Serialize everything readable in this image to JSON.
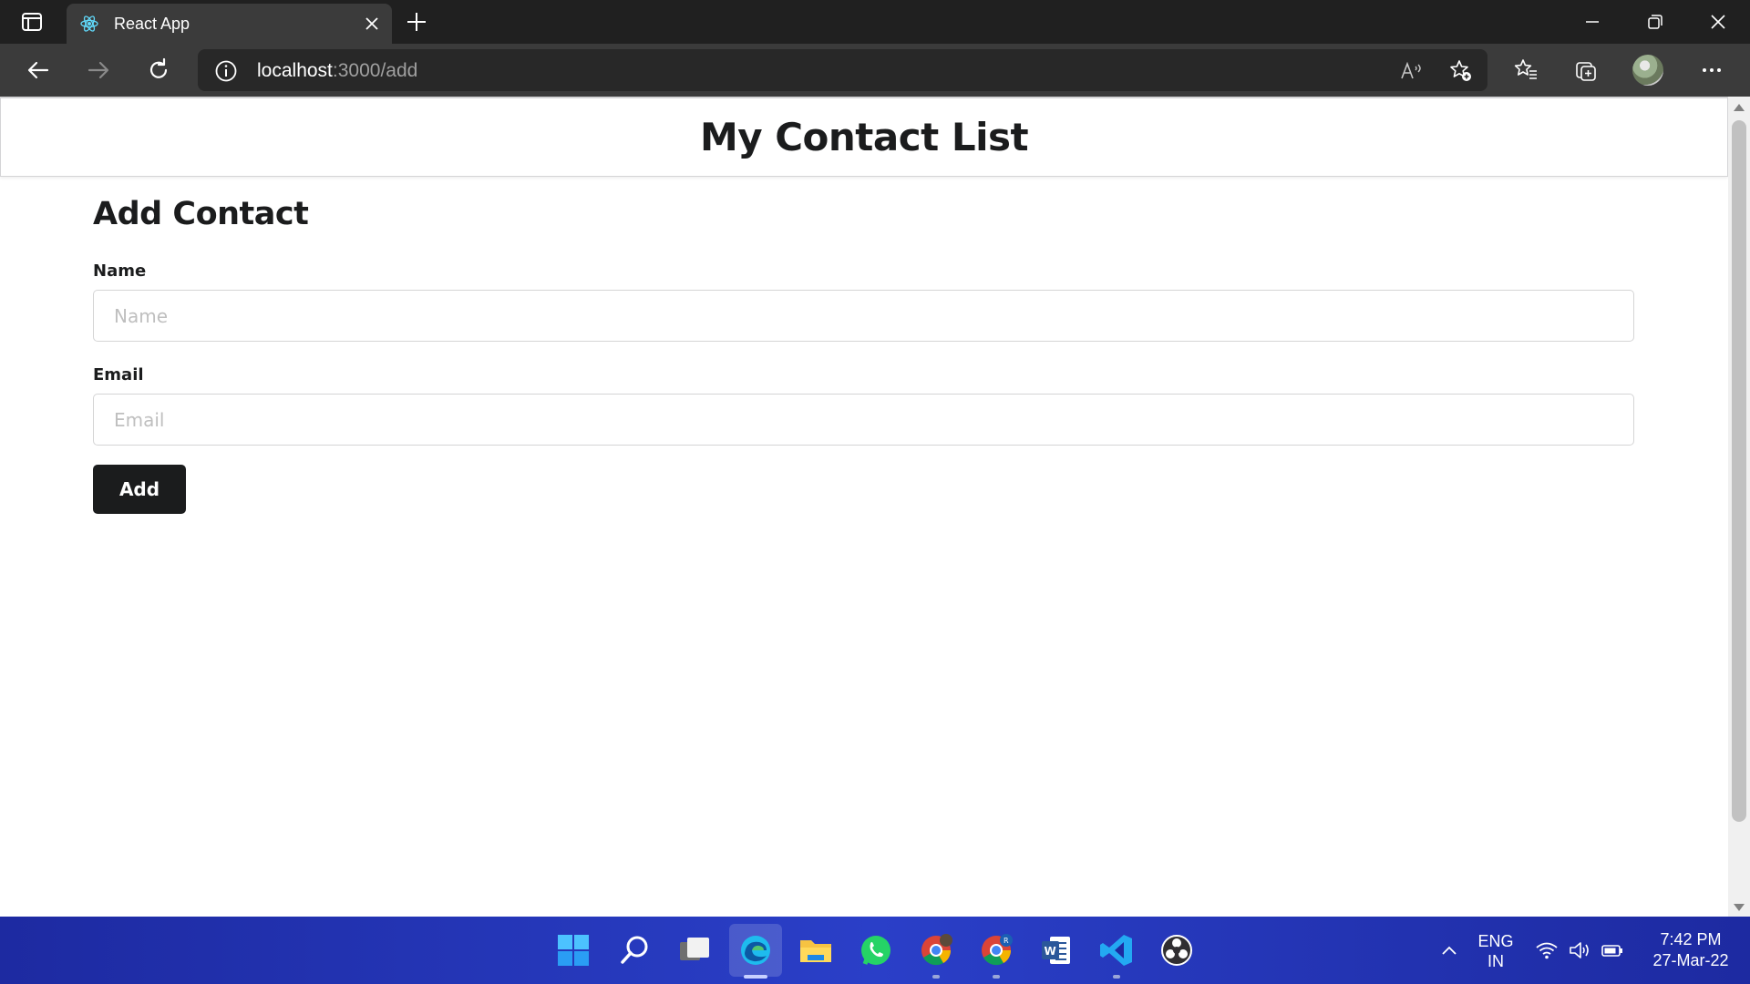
{
  "browser": {
    "tab": {
      "title": "React App",
      "favicon": "react-icon"
    },
    "url_host": "localhost",
    "url_path": ":3000/add",
    "icons": [
      "tabs-icon",
      "close-icon",
      "plus-icon",
      "minimize-icon",
      "restore-icon",
      "window-close-icon",
      "back-icon",
      "forward-icon",
      "refresh-icon",
      "info-icon",
      "read-aloud-icon",
      "add-favorite-icon",
      "favorites-icon",
      "collections-icon",
      "more-icon"
    ]
  },
  "app": {
    "header_title": "My Contact List",
    "form": {
      "title": "Add Contact",
      "name_label": "Name",
      "name_placeholder": "Name",
      "name_value": "",
      "email_label": "Email",
      "email_placeholder": "Email",
      "email_value": "",
      "submit_label": "Add"
    }
  },
  "taskbar": {
    "apps": [
      "windows-start-icon",
      "search-icon",
      "task-view-icon",
      "edge-icon",
      "file-explorer-icon",
      "whatsapp-icon",
      "chrome-icon",
      "chrome-profile-icon",
      "word-icon",
      "vscode-icon",
      "obs-icon"
    ],
    "tray": {
      "lang_top": "ENG",
      "lang_bottom": "IN",
      "time": "7:42 PM",
      "date": "27-Mar-22"
    }
  },
  "colors": {
    "header_text": "#1b1c1d",
    "button_bg": "#1b1c1d",
    "taskbar": "#2a3fc8",
    "browser_frame": "#202020"
  }
}
